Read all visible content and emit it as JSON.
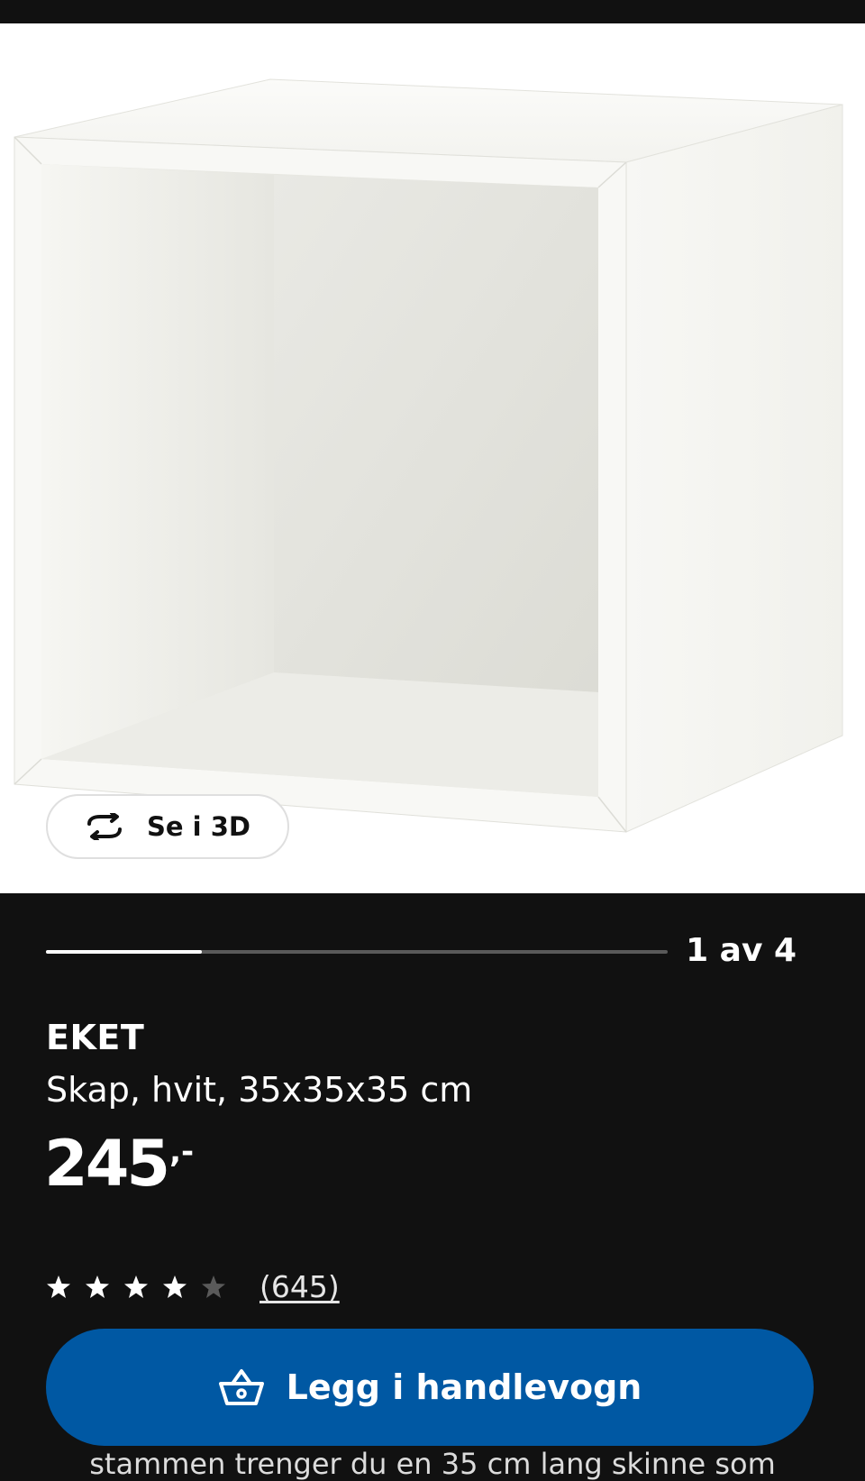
{
  "gallery": {
    "view_3d_label": "Se i 3D",
    "current_image": 1,
    "total_images": 4,
    "page_indicator": "1 av 4",
    "progress_fraction": 0.25
  },
  "product": {
    "name": "EKET",
    "description": "Skap, hvit, 35x35x35 cm",
    "price_integer": "245",
    "price_decimals": ",-",
    "rating": 4,
    "rating_max": 5,
    "review_count": "(645)"
  },
  "actions": {
    "add_to_cart_label": "Legg i handlevogn"
  },
  "details": {
    "snippet": "stammen trenger du en 35 cm lang skinne som"
  },
  "colors": {
    "background": "#111111",
    "primary_button": "#0058a3",
    "text": "#ffffff",
    "star_filled": "#ffffff",
    "star_empty": "#5a5a5a"
  },
  "icons": {
    "view_3d": "rotate-arrows-icon",
    "cart": "shopping-basket-icon",
    "star": "star-icon"
  }
}
